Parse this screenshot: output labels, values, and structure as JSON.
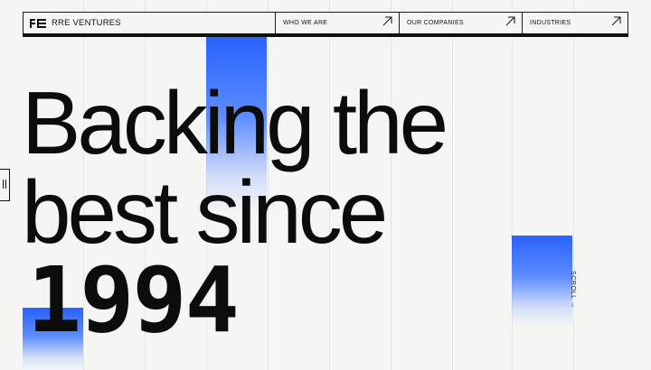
{
  "brand": {
    "name": "RRE VENTURES",
    "logo_icon": "rre-logo-icon"
  },
  "nav": {
    "items": [
      {
        "label": "WHO WE ARE",
        "icon": "arrow-up-right-icon"
      },
      {
        "label": "OUR COMPANIES",
        "icon": "arrow-up-right-icon"
      },
      {
        "label": "INDUSTRIES",
        "icon": "arrow-up-right-icon"
      }
    ]
  },
  "hero": {
    "line1": "Backing the",
    "line2": "best since",
    "year": "1994"
  },
  "scroll": {
    "label": "SCROLL",
    "arrow": "→"
  },
  "colors": {
    "accent": "#2962ff",
    "background": "#f5f5f4",
    "text": "#0c0c0c"
  }
}
